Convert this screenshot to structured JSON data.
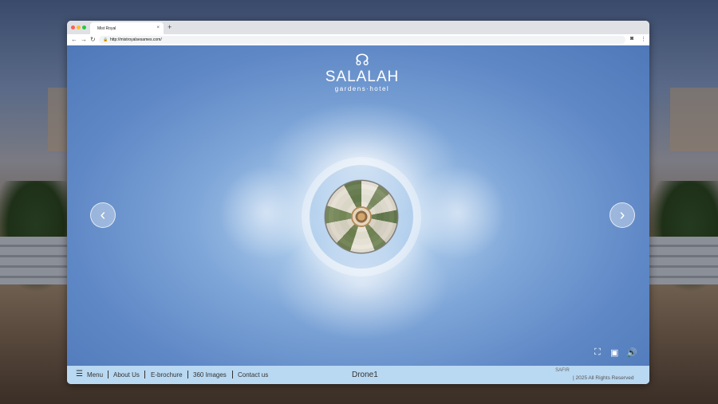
{
  "browser": {
    "tab_title": "Mist Royal",
    "tab_close": "×",
    "new_tab": "+",
    "url": "http://mistroyalsesames.com/",
    "back": "←",
    "forward": "→",
    "reload": "↻",
    "lock_icon": "🔒",
    "profile_icon": "◙",
    "menu_icon": "⋮"
  },
  "logo": {
    "mark": "☊",
    "name": "SALALAH",
    "subtitle": "gardens·hotel"
  },
  "viewer": {
    "prev": "‹",
    "next": "›",
    "fullscreen": "⛶",
    "vr": "▣",
    "sound": "🔊"
  },
  "bottom": {
    "menu_icon": "☰",
    "menu": "Menu",
    "about": "About Us",
    "ebrochure": "E-brochure",
    "images360": "360 Images",
    "contact": "Contact us",
    "scene_title": "Drone1",
    "brand": "SAFIR",
    "copyright": "| 2025 All Rights Reserved"
  }
}
